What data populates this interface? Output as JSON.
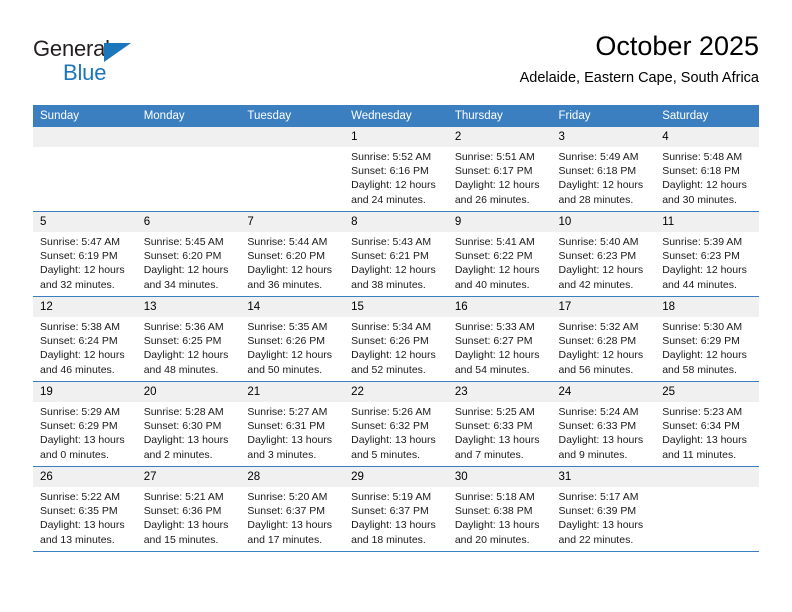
{
  "logo": {
    "word_one": "General",
    "word_two": "Blue",
    "triangle_color": "#1b76bc"
  },
  "header": {
    "title": "October 2025",
    "subtitle": "Adelaide, Eastern Cape, South Africa",
    "header_bg": "#3c7fc1",
    "daynum_bg": "#f0f0f0"
  },
  "weekday_headers": [
    "Sunday",
    "Monday",
    "Tuesday",
    "Wednesday",
    "Thursday",
    "Friday",
    "Saturday"
  ],
  "weeks": [
    [
      {
        "day": "",
        "sunrise": "",
        "sunset": "",
        "daylight_line1": "",
        "daylight_line2": ""
      },
      {
        "day": "",
        "sunrise": "",
        "sunset": "",
        "daylight_line1": "",
        "daylight_line2": ""
      },
      {
        "day": "",
        "sunrise": "",
        "sunset": "",
        "daylight_line1": "",
        "daylight_line2": ""
      },
      {
        "day": "1",
        "sunrise": "Sunrise: 5:52 AM",
        "sunset": "Sunset: 6:16 PM",
        "daylight_line1": "Daylight: 12 hours",
        "daylight_line2": "and 24 minutes."
      },
      {
        "day": "2",
        "sunrise": "Sunrise: 5:51 AM",
        "sunset": "Sunset: 6:17 PM",
        "daylight_line1": "Daylight: 12 hours",
        "daylight_line2": "and 26 minutes."
      },
      {
        "day": "3",
        "sunrise": "Sunrise: 5:49 AM",
        "sunset": "Sunset: 6:18 PM",
        "daylight_line1": "Daylight: 12 hours",
        "daylight_line2": "and 28 minutes."
      },
      {
        "day": "4",
        "sunrise": "Sunrise: 5:48 AM",
        "sunset": "Sunset: 6:18 PM",
        "daylight_line1": "Daylight: 12 hours",
        "daylight_line2": "and 30 minutes."
      }
    ],
    [
      {
        "day": "5",
        "sunrise": "Sunrise: 5:47 AM",
        "sunset": "Sunset: 6:19 PM",
        "daylight_line1": "Daylight: 12 hours",
        "daylight_line2": "and 32 minutes."
      },
      {
        "day": "6",
        "sunrise": "Sunrise: 5:45 AM",
        "sunset": "Sunset: 6:20 PM",
        "daylight_line1": "Daylight: 12 hours",
        "daylight_line2": "and 34 minutes."
      },
      {
        "day": "7",
        "sunrise": "Sunrise: 5:44 AM",
        "sunset": "Sunset: 6:20 PM",
        "daylight_line1": "Daylight: 12 hours",
        "daylight_line2": "and 36 minutes."
      },
      {
        "day": "8",
        "sunrise": "Sunrise: 5:43 AM",
        "sunset": "Sunset: 6:21 PM",
        "daylight_line1": "Daylight: 12 hours",
        "daylight_line2": "and 38 minutes."
      },
      {
        "day": "9",
        "sunrise": "Sunrise: 5:41 AM",
        "sunset": "Sunset: 6:22 PM",
        "daylight_line1": "Daylight: 12 hours",
        "daylight_line2": "and 40 minutes."
      },
      {
        "day": "10",
        "sunrise": "Sunrise: 5:40 AM",
        "sunset": "Sunset: 6:23 PM",
        "daylight_line1": "Daylight: 12 hours",
        "daylight_line2": "and 42 minutes."
      },
      {
        "day": "11",
        "sunrise": "Sunrise: 5:39 AM",
        "sunset": "Sunset: 6:23 PM",
        "daylight_line1": "Daylight: 12 hours",
        "daylight_line2": "and 44 minutes."
      }
    ],
    [
      {
        "day": "12",
        "sunrise": "Sunrise: 5:38 AM",
        "sunset": "Sunset: 6:24 PM",
        "daylight_line1": "Daylight: 12 hours",
        "daylight_line2": "and 46 minutes."
      },
      {
        "day": "13",
        "sunrise": "Sunrise: 5:36 AM",
        "sunset": "Sunset: 6:25 PM",
        "daylight_line1": "Daylight: 12 hours",
        "daylight_line2": "and 48 minutes."
      },
      {
        "day": "14",
        "sunrise": "Sunrise: 5:35 AM",
        "sunset": "Sunset: 6:26 PM",
        "daylight_line1": "Daylight: 12 hours",
        "daylight_line2": "and 50 minutes."
      },
      {
        "day": "15",
        "sunrise": "Sunrise: 5:34 AM",
        "sunset": "Sunset: 6:26 PM",
        "daylight_line1": "Daylight: 12 hours",
        "daylight_line2": "and 52 minutes."
      },
      {
        "day": "16",
        "sunrise": "Sunrise: 5:33 AM",
        "sunset": "Sunset: 6:27 PM",
        "daylight_line1": "Daylight: 12 hours",
        "daylight_line2": "and 54 minutes."
      },
      {
        "day": "17",
        "sunrise": "Sunrise: 5:32 AM",
        "sunset": "Sunset: 6:28 PM",
        "daylight_line1": "Daylight: 12 hours",
        "daylight_line2": "and 56 minutes."
      },
      {
        "day": "18",
        "sunrise": "Sunrise: 5:30 AM",
        "sunset": "Sunset: 6:29 PM",
        "daylight_line1": "Daylight: 12 hours",
        "daylight_line2": "and 58 minutes."
      }
    ],
    [
      {
        "day": "19",
        "sunrise": "Sunrise: 5:29 AM",
        "sunset": "Sunset: 6:29 PM",
        "daylight_line1": "Daylight: 13 hours",
        "daylight_line2": "and 0 minutes."
      },
      {
        "day": "20",
        "sunrise": "Sunrise: 5:28 AM",
        "sunset": "Sunset: 6:30 PM",
        "daylight_line1": "Daylight: 13 hours",
        "daylight_line2": "and 2 minutes."
      },
      {
        "day": "21",
        "sunrise": "Sunrise: 5:27 AM",
        "sunset": "Sunset: 6:31 PM",
        "daylight_line1": "Daylight: 13 hours",
        "daylight_line2": "and 3 minutes."
      },
      {
        "day": "22",
        "sunrise": "Sunrise: 5:26 AM",
        "sunset": "Sunset: 6:32 PM",
        "daylight_line1": "Daylight: 13 hours",
        "daylight_line2": "and 5 minutes."
      },
      {
        "day": "23",
        "sunrise": "Sunrise: 5:25 AM",
        "sunset": "Sunset: 6:33 PM",
        "daylight_line1": "Daylight: 13 hours",
        "daylight_line2": "and 7 minutes."
      },
      {
        "day": "24",
        "sunrise": "Sunrise: 5:24 AM",
        "sunset": "Sunset: 6:33 PM",
        "daylight_line1": "Daylight: 13 hours",
        "daylight_line2": "and 9 minutes."
      },
      {
        "day": "25",
        "sunrise": "Sunrise: 5:23 AM",
        "sunset": "Sunset: 6:34 PM",
        "daylight_line1": "Daylight: 13 hours",
        "daylight_line2": "and 11 minutes."
      }
    ],
    [
      {
        "day": "26",
        "sunrise": "Sunrise: 5:22 AM",
        "sunset": "Sunset: 6:35 PM",
        "daylight_line1": "Daylight: 13 hours",
        "daylight_line2": "and 13 minutes."
      },
      {
        "day": "27",
        "sunrise": "Sunrise: 5:21 AM",
        "sunset": "Sunset: 6:36 PM",
        "daylight_line1": "Daylight: 13 hours",
        "daylight_line2": "and 15 minutes."
      },
      {
        "day": "28",
        "sunrise": "Sunrise: 5:20 AM",
        "sunset": "Sunset: 6:37 PM",
        "daylight_line1": "Daylight: 13 hours",
        "daylight_line2": "and 17 minutes."
      },
      {
        "day": "29",
        "sunrise": "Sunrise: 5:19 AM",
        "sunset": "Sunset: 6:37 PM",
        "daylight_line1": "Daylight: 13 hours",
        "daylight_line2": "and 18 minutes."
      },
      {
        "day": "30",
        "sunrise": "Sunrise: 5:18 AM",
        "sunset": "Sunset: 6:38 PM",
        "daylight_line1": "Daylight: 13 hours",
        "daylight_line2": "and 20 minutes."
      },
      {
        "day": "31",
        "sunrise": "Sunrise: 5:17 AM",
        "sunset": "Sunset: 6:39 PM",
        "daylight_line1": "Daylight: 13 hours",
        "daylight_line2": "and 22 minutes."
      },
      {
        "day": "",
        "sunrise": "",
        "sunset": "",
        "daylight_line1": "",
        "daylight_line2": ""
      }
    ]
  ]
}
